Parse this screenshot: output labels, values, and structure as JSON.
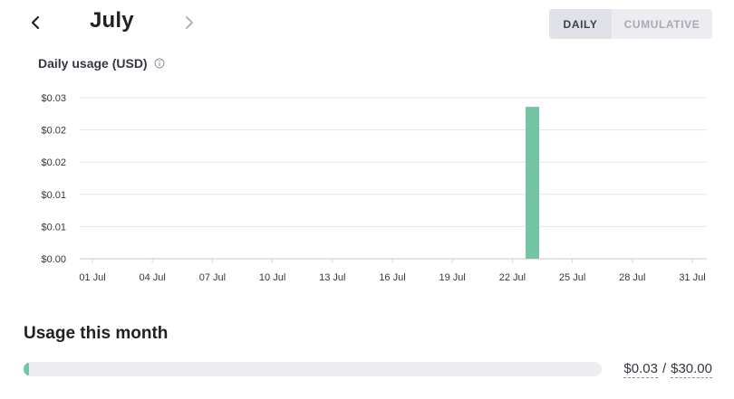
{
  "header": {
    "month": "July",
    "prev_icon": "chevron-left-icon",
    "next_icon": "chevron-right-icon"
  },
  "view_toggle": {
    "daily_label": "DAILY",
    "cumulative_label": "CUMULATIVE",
    "selected": "daily"
  },
  "chart_data": {
    "type": "bar",
    "title": "Daily usage (USD)",
    "info_icon": "info-icon",
    "y_tick_labels": [
      "$0.00",
      "$0.01",
      "$0.01",
      "$0.02",
      "$0.02",
      "$0.03"
    ],
    "x_tick_labels": [
      "01 Jul",
      "04 Jul",
      "07 Jul",
      "10 Jul",
      "13 Jul",
      "16 Jul",
      "19 Jul",
      "22 Jul",
      "25 Jul",
      "28 Jul",
      "31 Jul"
    ],
    "ylim": [
      0,
      0.03
    ],
    "xlim": [
      1,
      31
    ],
    "bars": [
      {
        "day": 23,
        "label": "23 Jul",
        "value": 0.0283
      }
    ],
    "bar_color": "#74c5a4",
    "grid": true
  },
  "usage": {
    "title": "Usage this month",
    "used": "$0.03",
    "limit": "$30.00",
    "separator": "/",
    "fraction": 0.001,
    "color": "#74c5a4"
  }
}
